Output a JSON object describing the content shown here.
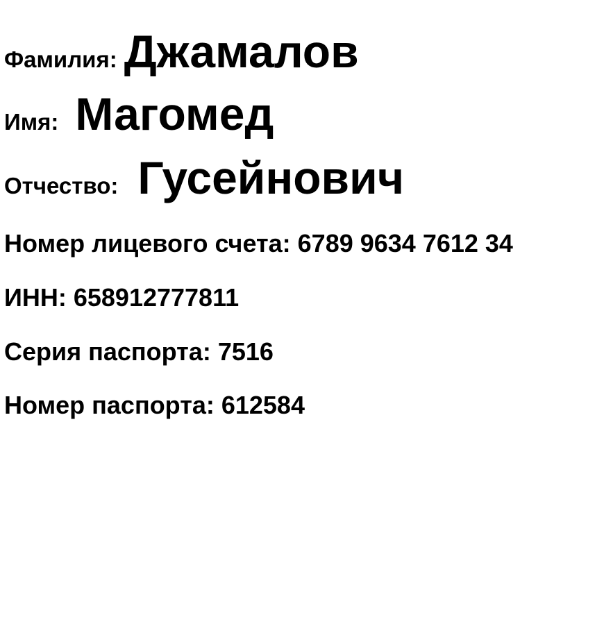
{
  "person": {
    "surname_label": "Фамилия:",
    "surname": "Джамалов",
    "name_label": "Имя:",
    "name": "Магомед",
    "patronymic_label": "Отчество:",
    "patronymic": "Гусейнович"
  },
  "details": {
    "account": "Номер лицевого счета: 6789 9634 7612 34",
    "inn": "ИНН: 658912777811",
    "passport_series": "Серия паспорта: 7516",
    "passport_number": "Номер паспорта: 612584"
  }
}
